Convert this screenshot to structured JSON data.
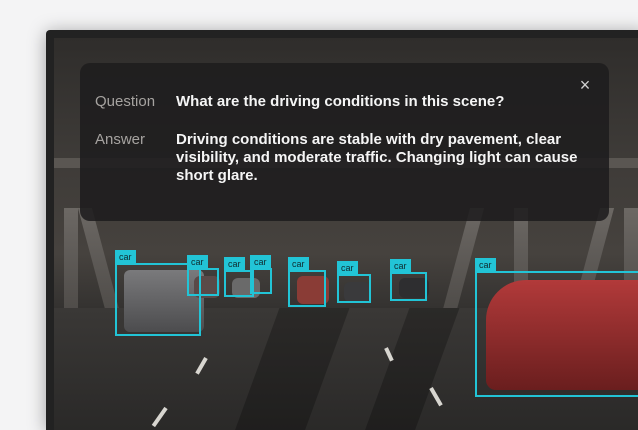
{
  "qa": {
    "question_label": "Question",
    "question_text": "What are the driving conditions in this scene?",
    "answer_label": "Answer",
    "answer_text": "Driving conditions are stable with dry pavement, clear visibility, and moderate traffic. Changing light can cause short glare.",
    "close_symbol": "×"
  },
  "detections": [
    {
      "label": "car"
    },
    {
      "label": "car"
    },
    {
      "label": "car"
    },
    {
      "label": "car"
    },
    {
      "label": "car"
    },
    {
      "label": "car"
    },
    {
      "label": "car"
    },
    {
      "label": "car"
    }
  ],
  "colors": {
    "bbox": "#22c4d6",
    "panel": "#1e1d1e"
  }
}
